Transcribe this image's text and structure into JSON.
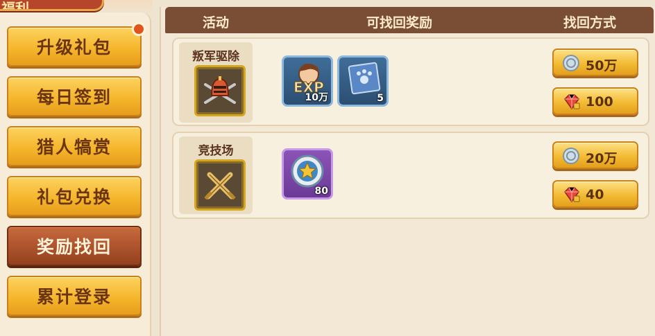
{
  "corner_banner": {
    "text": "福利"
  },
  "sidebar": {
    "items": [
      {
        "label": "升级礼包",
        "active": false,
        "has_badge": true
      },
      {
        "label": "每日签到",
        "active": false,
        "has_badge": false
      },
      {
        "label": "猎人犒赏",
        "active": false,
        "has_badge": false
      },
      {
        "label": "礼包兑换",
        "active": false,
        "has_badge": false
      },
      {
        "label": "奖励找回",
        "active": true,
        "has_badge": false
      },
      {
        "label": "累计登录",
        "active": false,
        "has_badge": false
      }
    ]
  },
  "header": {
    "col_activity": "活动",
    "col_rewards": "可找回奖励",
    "col_method": "找回方式"
  },
  "rows": [
    {
      "activity": "叛军驱除",
      "activity_icon": "knight-helmet-icon",
      "rewards": [
        {
          "icon": "exp-hero-icon",
          "qty": "10万"
        },
        {
          "icon": "paw-map-scroll-icon",
          "qty": "5"
        }
      ],
      "options": [
        {
          "currency": "silver-coin-icon",
          "amount": "50万"
        },
        {
          "currency": "gem-icon",
          "amount": "100"
        }
      ]
    },
    {
      "activity": "竞技场",
      "activity_icon": "crossed-swords-icon",
      "rewards": [
        {
          "icon": "star-medal-icon",
          "qty": "80"
        }
      ],
      "options": [
        {
          "currency": "silver-coin-icon",
          "amount": "20万"
        },
        {
          "currency": "gem-icon",
          "amount": "40"
        }
      ]
    }
  ],
  "colors": {
    "header_bg": "#7a4e34",
    "button_gold": "#f3bb34",
    "button_active": "#a9502b"
  }
}
